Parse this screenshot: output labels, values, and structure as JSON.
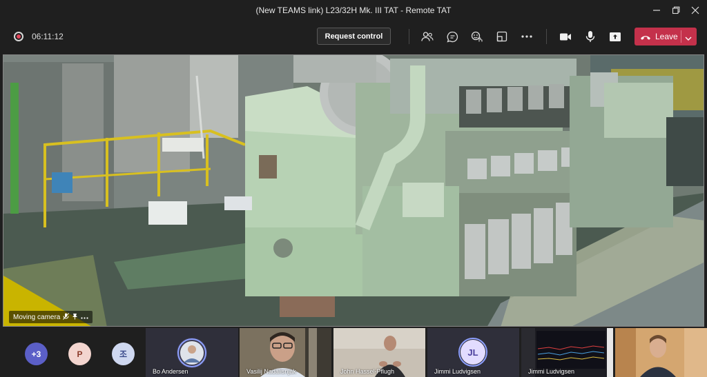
{
  "window": {
    "title": "(New TEAMS link) L23/32H Mk. III TAT - Remote TAT"
  },
  "toolbar": {
    "timer": "06:11:12",
    "request_control_label": "Request control",
    "leave_label": "Leave",
    "accent_color": "#c4314b"
  },
  "stage": {
    "camera_label": "Moving camera"
  },
  "participants": {
    "overflow": {
      "label": "+3",
      "color": "#5b5fc7"
    },
    "avatar_p": {
      "label": "P",
      "color": "#f3d5cf"
    },
    "avatar_jo": {
      "label": "조",
      "color": "#cfd8f0"
    },
    "tiles": [
      {
        "name": "Bo Andersen"
      },
      {
        "name": "Vasilij Nadalisnjak"
      },
      {
        "name": "John Hassel-Pflugh"
      },
      {
        "name": "Jimmi Ludvigsen",
        "initials": "JL"
      },
      {
        "name": "Jimmi Ludvigsen"
      }
    ]
  }
}
